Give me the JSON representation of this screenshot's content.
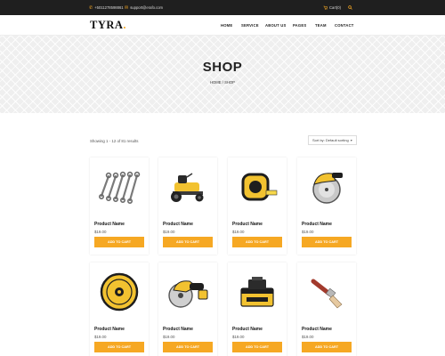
{
  "topbar": {
    "phone": "+5011278598861",
    "email": "support@erafo.com",
    "cart": "Cart(0)"
  },
  "brand": {
    "logo": "TYRA",
    "accent": "#f6a823"
  },
  "nav": [
    "HOME",
    "SERVICE",
    "ABOUT US",
    "PAGES",
    "TEAM",
    "CONTACT"
  ],
  "banner": {
    "title": "SHOP",
    "breadcrumb_home": "HOME",
    "breadcrumb_sep": "/",
    "breadcrumb_current": "SHOP"
  },
  "results": {
    "text": "Showing 1 - 12 of 81 results"
  },
  "sort": {
    "label": "Sort by: Default sorting"
  },
  "products": [
    {
      "name": "Product Name",
      "price": "$19.00",
      "button": "ADD TO CART",
      "icon": "wrench-set-icon"
    },
    {
      "name": "Product Name",
      "price": "$19.00",
      "button": "ADD TO CART",
      "icon": "riding-mower-icon"
    },
    {
      "name": "Product Name",
      "price": "$19.00",
      "button": "ADD TO CART",
      "icon": "tape-measure-icon"
    },
    {
      "name": "Product Name",
      "price": "$19.00",
      "button": "ADD TO CART",
      "icon": "circular-saw-icon"
    },
    {
      "name": "Product Name",
      "price": "$19.00",
      "button": "ADD TO CART",
      "icon": "saw-blade-icon"
    },
    {
      "name": "Product Name",
      "price": "$19.00",
      "button": "ADD TO CART",
      "icon": "cordless-circular-saw-icon"
    },
    {
      "name": "Product Name",
      "price": "$19.00",
      "button": "ADD TO CART",
      "icon": "battery-pack-icon"
    },
    {
      "name": "Product Name",
      "price": "$19.00",
      "button": "ADD TO CART",
      "icon": "paint-brush-icon"
    }
  ]
}
